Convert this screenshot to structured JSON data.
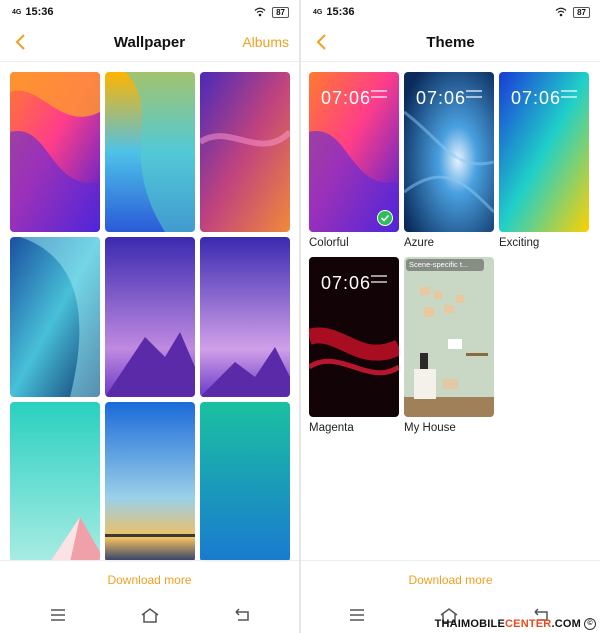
{
  "left_screen": {
    "status": {
      "signal": "4G",
      "time": "15:36",
      "battery": "87"
    },
    "header": {
      "title": "Wallpaper",
      "albums_label": "Albums"
    },
    "download_label": "Download more"
  },
  "right_screen": {
    "status": {
      "signal": "4G",
      "time": "15:36",
      "battery": "87"
    },
    "header": {
      "title": "Theme"
    },
    "themes": [
      {
        "name": "Colorful",
        "clock": "07:06",
        "selected": true
      },
      {
        "name": "Azure",
        "clock": "07:06"
      },
      {
        "name": "Exciting",
        "clock": "07:06"
      },
      {
        "name": "Magenta",
        "clock": "07:06"
      },
      {
        "name": "My House",
        "tag": "Scene-specific t..."
      }
    ],
    "download_label": "Download more"
  },
  "watermark": {
    "part1": "THAIMOBILE",
    "part2": "CENTER",
    "part3": ".COM",
    "symbol": "©"
  },
  "colors": {
    "accent": "#f0a020",
    "check": "#2ebd59"
  }
}
